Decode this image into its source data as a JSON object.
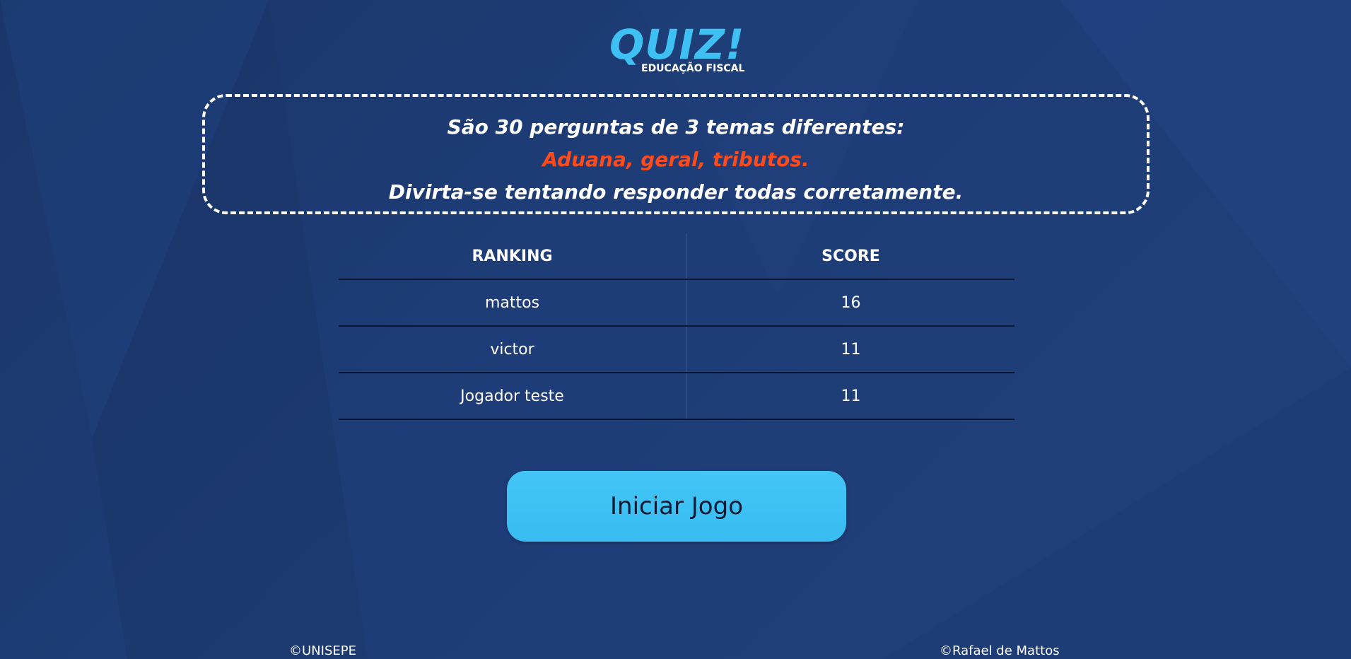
{
  "logo": {
    "title": "QUIZ!",
    "subtitle": "EDUCAÇÃO FISCAL"
  },
  "info": {
    "line1": "São 30 perguntas de 3 temas diferentes:",
    "line2": "Aduana, geral, tributos.",
    "line3": "Divirta-se tentando responder todas corretamente."
  },
  "ranking": {
    "headers": [
      "RANKING",
      "SCORE"
    ],
    "rows": [
      {
        "name": "mattos",
        "score": "16"
      },
      {
        "name": "victor",
        "score": "11"
      },
      {
        "name": "Jogador teste",
        "score": "11"
      }
    ]
  },
  "start_button": {
    "label": "Iniciar Jogo"
  },
  "footer": {
    "left": "©UNISEPE",
    "right": "©Rafael de Mattos"
  },
  "colors": {
    "background": "#1e3d78",
    "logo_accent": "#3ec1f2",
    "topic_accent": "#ff4a1c",
    "button": "#3ec1f2",
    "button_text": "#0c1a33"
  }
}
